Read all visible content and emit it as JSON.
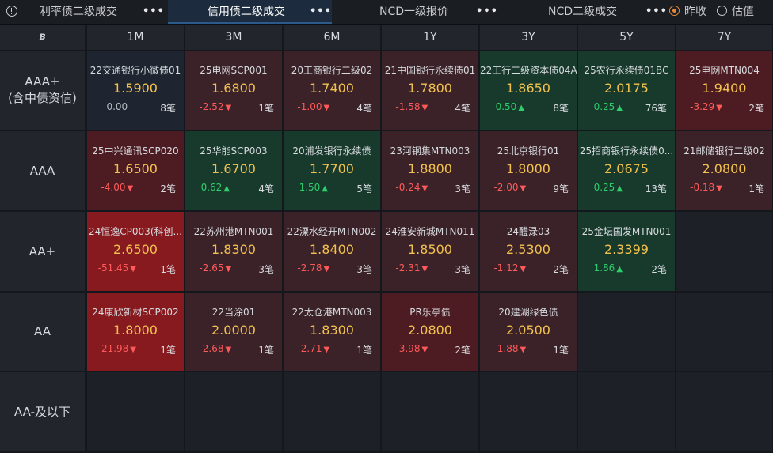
{
  "tabs": [
    {
      "label": "利率债二级成交",
      "active": false
    },
    {
      "label": "信用债二级成交",
      "active": true
    },
    {
      "label": "NCD一级报价",
      "active": false
    },
    {
      "label": "NCD二级成交",
      "active": false
    }
  ],
  "more_label": "•••",
  "radios": [
    {
      "label": "昨收",
      "selected": true
    },
    {
      "label": "估值",
      "selected": false
    }
  ],
  "logo_text": "ʙ",
  "tenors": [
    "1M",
    "3M",
    "6M",
    "1Y",
    "3Y",
    "5Y",
    "7Y"
  ],
  "ratings": [
    {
      "label": "AAA+\n(含中债资信)"
    },
    {
      "label": "AAA"
    },
    {
      "label": "AA+"
    },
    {
      "label": "AA"
    },
    {
      "label": "AA-及以下"
    }
  ],
  "colors": {
    "neutral": "#1f2530",
    "light_red": "#3a2228",
    "red": "#4d1c22",
    "deep_red": "#871a1f",
    "green": "#173a2c",
    "empty": "#1d2026"
  },
  "grid": [
    [
      {
        "name": "22交通银行小微债01",
        "price": "1.5900",
        "change": "0.00",
        "dir": "flat",
        "count": "8笔",
        "bg": "neutral"
      },
      {
        "name": "25电网SCP001",
        "price": "1.6800",
        "change": "-2.52",
        "dir": "down",
        "count": "1笔",
        "bg": "light_red"
      },
      {
        "name": "20工商银行二级02",
        "price": "1.7400",
        "change": "-1.00",
        "dir": "down",
        "count": "4笔",
        "bg": "light_red"
      },
      {
        "name": "21中国银行永续债01",
        "price": "1.7800",
        "change": "-1.58",
        "dir": "down",
        "count": "4笔",
        "bg": "light_red"
      },
      {
        "name": "22工行二级资本债04A",
        "price": "1.8650",
        "change": "0.50",
        "dir": "up",
        "count": "8笔",
        "bg": "green"
      },
      {
        "name": "25农行永续债01BC",
        "price": "2.0175",
        "change": "0.25",
        "dir": "up",
        "count": "76笔",
        "bg": "green"
      },
      {
        "name": "25电网MTN004",
        "price": "1.9400",
        "change": "-3.29",
        "dir": "down",
        "count": "2笔",
        "bg": "red"
      }
    ],
    [
      {
        "name": "25中兴通讯SCP020",
        "price": "1.6500",
        "change": "-4.00",
        "dir": "down",
        "count": "2笔",
        "bg": "red"
      },
      {
        "name": "25华能SCP003",
        "price": "1.6700",
        "change": "0.62",
        "dir": "up",
        "count": "4笔",
        "bg": "green"
      },
      {
        "name": "20浦发银行永续债",
        "price": "1.7700",
        "change": "1.50",
        "dir": "up",
        "count": "5笔",
        "bg": "green"
      },
      {
        "name": "23河钢集MTN003",
        "price": "1.8800",
        "change": "-0.24",
        "dir": "down",
        "count": "3笔",
        "bg": "light_red"
      },
      {
        "name": "25北京银行01",
        "price": "1.8000",
        "change": "-2.00",
        "dir": "down",
        "count": "9笔",
        "bg": "light_red"
      },
      {
        "name": "25招商银行永续债0...",
        "price": "2.0675",
        "change": "0.25",
        "dir": "up",
        "count": "13笔",
        "bg": "green"
      },
      {
        "name": "21邮储银行二级02",
        "price": "2.0800",
        "change": "-0.18",
        "dir": "down",
        "count": "1笔",
        "bg": "light_red"
      }
    ],
    [
      {
        "name": "24恒逸CP003(科创...",
        "price": "2.6500",
        "change": "-51.45",
        "dir": "down",
        "count": "1笔",
        "bg": "deep_red"
      },
      {
        "name": "22苏州港MTN001",
        "price": "1.8300",
        "change": "-2.65",
        "dir": "down",
        "count": "3笔",
        "bg": "light_red"
      },
      {
        "name": "22溧水经开MTN002",
        "price": "1.8400",
        "change": "-2.78",
        "dir": "down",
        "count": "3笔",
        "bg": "light_red"
      },
      {
        "name": "24淮安新城MTN011",
        "price": "1.8500",
        "change": "-2.31",
        "dir": "down",
        "count": "3笔",
        "bg": "light_red"
      },
      {
        "name": "24醴渌03",
        "price": "2.5300",
        "change": "-1.12",
        "dir": "down",
        "count": "2笔",
        "bg": "light_red"
      },
      {
        "name": "25金坛国发MTN001",
        "price": "2.3399",
        "change": "1.86",
        "dir": "up",
        "count": "2笔",
        "bg": "green"
      },
      null
    ],
    [
      {
        "name": "24康欣新材SCP002",
        "price": "1.8000",
        "change": "-21.98",
        "dir": "down",
        "count": "1笔",
        "bg": "deep_red"
      },
      {
        "name": "22当涂01",
        "price": "2.0000",
        "change": "-2.68",
        "dir": "down",
        "count": "1笔",
        "bg": "light_red"
      },
      {
        "name": "22太仓港MTN003",
        "price": "1.8300",
        "change": "-2.71",
        "dir": "down",
        "count": "1笔",
        "bg": "light_red"
      },
      {
        "name": "PR乐亭债",
        "price": "2.0800",
        "change": "-3.98",
        "dir": "down",
        "count": "2笔",
        "bg": "red"
      },
      {
        "name": "20建湖绿色债",
        "price": "2.0500",
        "change": "-1.88",
        "dir": "down",
        "count": "1笔",
        "bg": "light_red"
      },
      null,
      null
    ],
    [
      null,
      null,
      null,
      null,
      null,
      null,
      null
    ]
  ]
}
